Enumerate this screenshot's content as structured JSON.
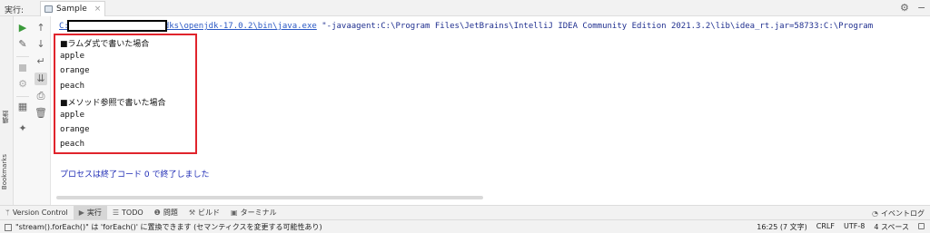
{
  "header": {
    "run_label": "実行:",
    "tab_label": "Sample",
    "tab_close": "×",
    "settings_icon": "⚙",
    "minimize_icon": "−"
  },
  "side_strip": {
    "structure_label": "構造",
    "bookmarks_label": "Bookmarks"
  },
  "console": {
    "cmd_link": "C:",
    "cmd_path_link": "dks\\openjdk-17.0.2\\bin\\java.exe",
    "cmd_rest": " \"-javaagent:C:\\Program Files\\JetBrains\\IntelliJ IDEA Community Edition 2021.3.2\\lib\\idea_rt.jar=58733:C:\\Program",
    "output_lines": [
      "■ラムダ式で書いた場合",
      "apple",
      "orange",
      "peach",
      "■メソッド参照で書いた場合",
      "apple",
      "orange",
      "peach"
    ],
    "exit_message": "プロセスは終了コード 0 で終了しました"
  },
  "bottom_tools": {
    "items": [
      {
        "icon": "ᛘ",
        "label": "Version Control"
      },
      {
        "icon": "▶",
        "label": "実行"
      },
      {
        "icon": "☰",
        "label": "TODO"
      },
      {
        "icon": "❶",
        "label": "問題"
      },
      {
        "icon": "⚒",
        "label": "ビルド"
      },
      {
        "icon": "▣",
        "label": "ターミナル"
      }
    ],
    "event_log": "イベントログ"
  },
  "status": {
    "message": "\"stream().forEach()\" は 'forEach()' に置換できます (セマンティクスを変更する可能性あり)",
    "position": "16:25 (7 文字)",
    "line_sep": "CRLF",
    "encoding": "UTF-8",
    "indent": "4 スペース"
  },
  "colors": {
    "highlight_border": "#e0242c",
    "exit_message": "#1e2bb5",
    "link": "#2a58c4",
    "run_green": "#3a9a3a"
  }
}
